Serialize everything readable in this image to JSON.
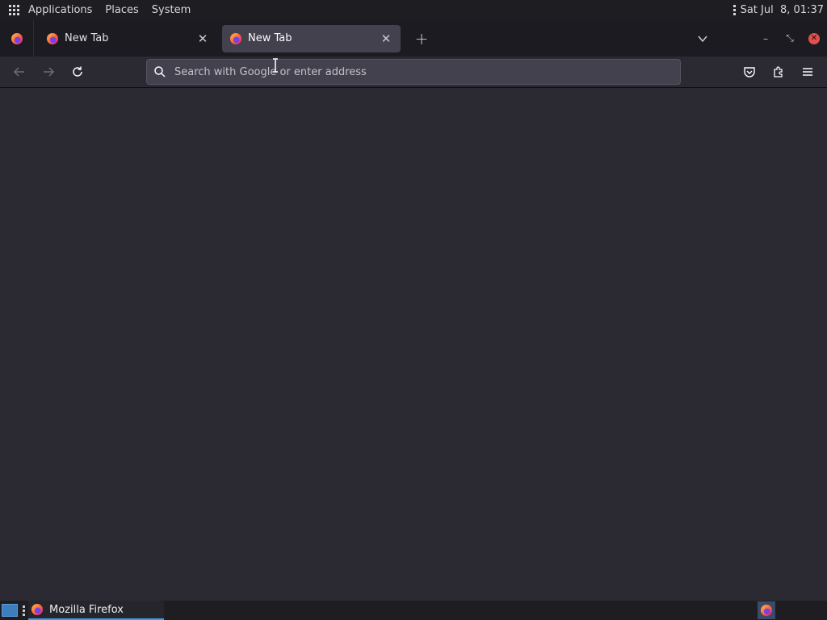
{
  "system_panel": {
    "menus": [
      "Applications",
      "Places",
      "System"
    ],
    "clock": "Sat Jul  8, 01:37"
  },
  "tabs": [
    {
      "label": "New Tab",
      "active": false
    },
    {
      "label": "New Tab",
      "active": true
    }
  ],
  "navbar": {
    "search_placeholder": "Search with Google or enter address"
  },
  "taskbar": {
    "window_label": "Mozilla Firefox"
  },
  "colors": {
    "content_bg": "#2b2a33",
    "tabstrip_bg": "#1c1b22",
    "active_tab_bg": "#42414d",
    "close_button": "#e0514e",
    "task_accent": "#3d9be9"
  },
  "icons": [
    "apps-grid-icon",
    "firefox-icon",
    "close-icon",
    "plus-icon",
    "chevron-down-icon",
    "minimize-icon",
    "restore-icon",
    "back-icon",
    "forward-icon",
    "reload-icon",
    "search-icon",
    "pocket-icon",
    "extensions-icon",
    "menu-icon"
  ]
}
